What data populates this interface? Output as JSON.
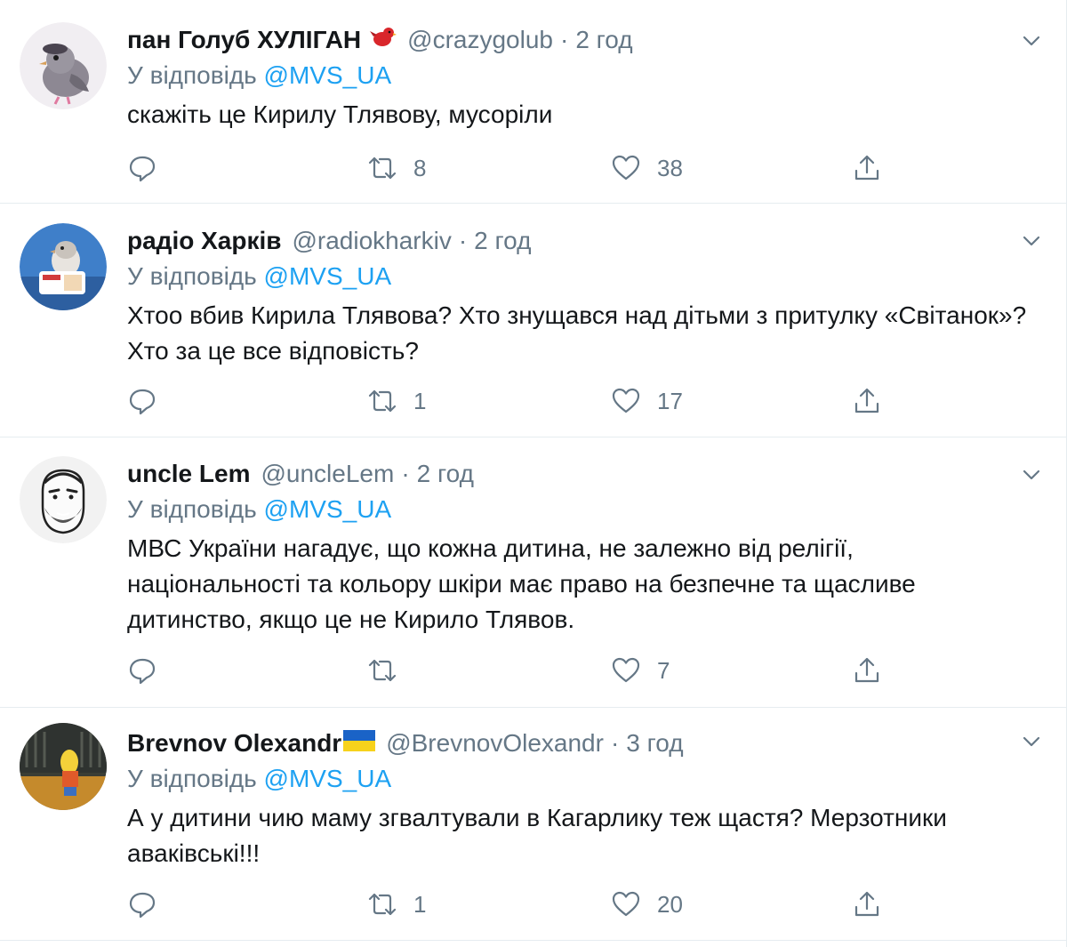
{
  "tweets": [
    {
      "name": "пан Голуб ХУЛІГАН",
      "handle": "@crazygolub",
      "separator": "·",
      "time": "2 год",
      "reply_prefix": "У відповідь",
      "reply_to": "@MVS_UA",
      "text": "скажіть це Кирилу Тлявову, мусоріли",
      "retweets": "8",
      "likes": "38",
      "badge": "red-bird-emoji",
      "avatar": "pigeon-avatar"
    },
    {
      "name": "радіо Харків",
      "handle": "@radiokharkiv",
      "separator": "·",
      "time": "2 год",
      "reply_prefix": "У відповідь",
      "reply_to": "@MVS_UA",
      "text": "Хтоо вбив Кирила Тлявова? Хто знущався над дітьми з притулку «Світанок»? Хто за це все відповість?",
      "retweets": "1",
      "likes": "17",
      "avatar": "pigeon-photo-avatar"
    },
    {
      "name": "uncle Lem",
      "handle": "@uncleLem",
      "separator": "·",
      "time": "2 год",
      "reply_prefix": "У відповідь",
      "reply_to": "@MVS_UA",
      "text": "МВС України нагадує, що кожна дитина, не залежно від релігії, національності та кольору шкіри має право на безпечне та щасливе дитинство, якщо це не Кирило Тлявов.",
      "retweets": "",
      "likes": "7",
      "avatar": "bearded-man-cartoon-avatar"
    },
    {
      "name": "Brevnov Olexandr",
      "handle": "@BrevnovOlexandr",
      "separator": "·",
      "time": "3 год",
      "reply_prefix": "У відповідь",
      "reply_to": "@MVS_UA",
      "text": "А у дитини чию маму згвалтували в Кагарлику теж щастя? Мерзотники аваківські!!!",
      "retweets": "1",
      "likes": "20",
      "badge": "ukraine-flag-emoji",
      "avatar": "cartoon-scene-avatar"
    }
  ],
  "colors": {
    "text": "#14171a",
    "secondary": "#657786",
    "link": "#1da1f2",
    "divider": "#e6ecf0"
  }
}
